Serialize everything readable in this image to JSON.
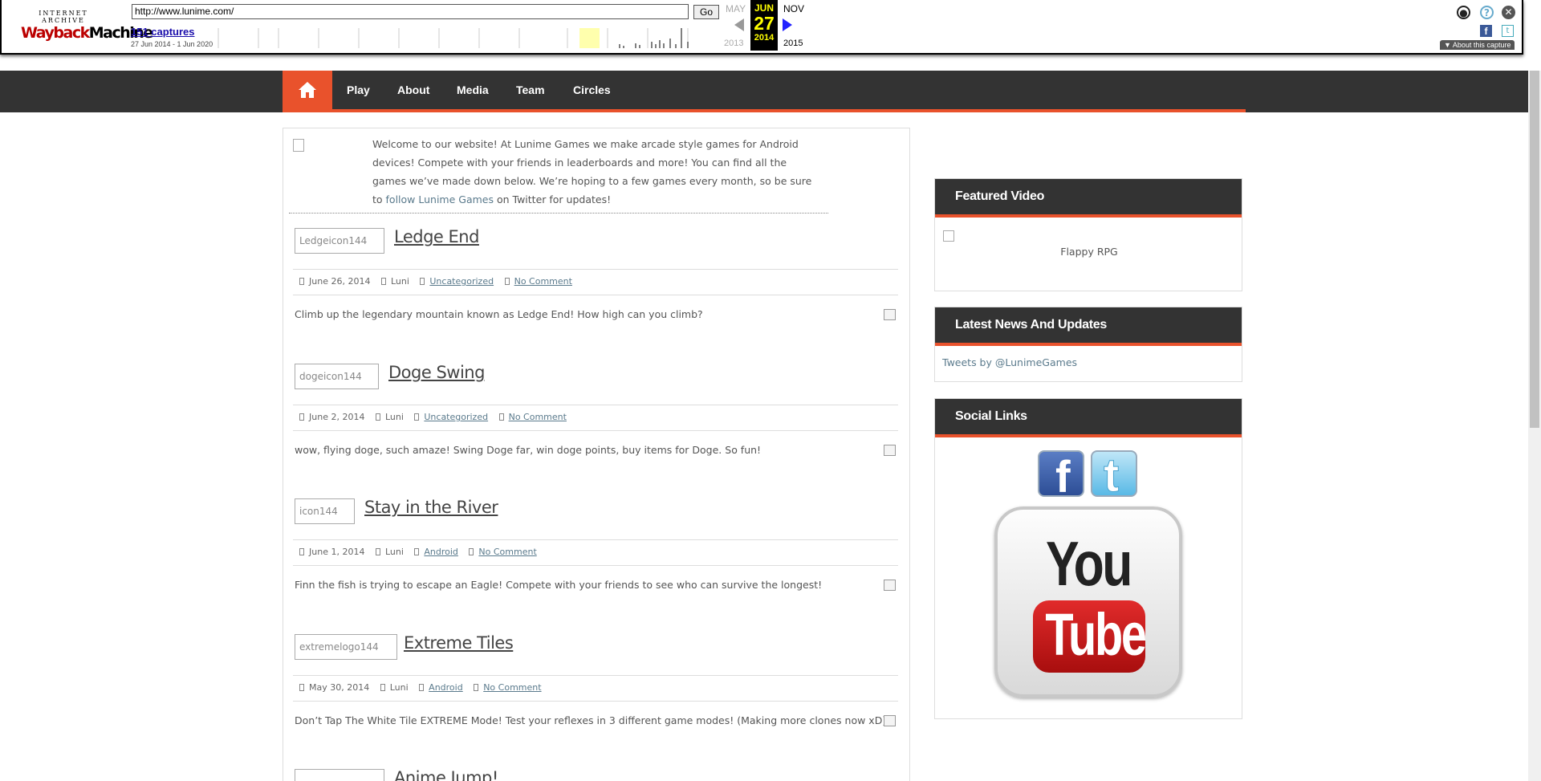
{
  "wayback": {
    "logo_top": "INTERNET ARCHIVE",
    "logo_main": "WaybackMachine",
    "url": "http://www.lunime.com/",
    "go_label": "Go",
    "captures_label": "151 captures",
    "range_label": "27 Jun 2014 - 1 Jun 2020",
    "prev_month": "MAY",
    "prev_year": "2013",
    "cur_month": "JUN",
    "cur_day": "27",
    "cur_year": "2014",
    "next_month": "NOV",
    "next_year": "2015",
    "about_label": "▼ About this capture",
    "icons": {
      "user": "user-icon",
      "help": "help-icon",
      "close": "close-icon",
      "facebook": "facebook-icon",
      "twitter": "twitter-icon"
    },
    "help_glyph": "?",
    "close_glyph": "✕",
    "fb_glyph": "f",
    "tw_glyph": "t"
  },
  "nav": {
    "home_icon": "home-icon",
    "items": [
      "Play",
      "About",
      "Media",
      "Team",
      "Circles"
    ]
  },
  "welcome": {
    "text": "Welcome to our website! At Lunime Games we make arcade style games for Android devices! Compete with your friends in leaderboards and more! You can find all the games we’ve made down below. We’re hoping to a few games every month, so be sure to ",
    "link": "follow Lunime Games",
    "tail": " on Twitter for updates!"
  },
  "posts": [
    {
      "thumb_alt": "Ledgeicon144",
      "title": "Ledge End",
      "date": "June 26, 2014",
      "author": "Luni",
      "category": "Uncategorized",
      "comments": "No Comment",
      "excerpt": "Climb up the legendary mountain known as Ledge End! How high can you climb?"
    },
    {
      "thumb_alt": "dogeicon144",
      "title": "Doge Swing",
      "date": "June 2, 2014",
      "author": "Luni",
      "category": "Uncategorized",
      "comments": "No Comment",
      "excerpt": "wow, flying doge, such amaze! Swing Doge far, win doge points, buy items for Doge. So fun!"
    },
    {
      "thumb_alt": "icon144",
      "title": "Stay in the River",
      "date": "June 1, 2014",
      "author": "Luni",
      "category": "Android",
      "comments": "No Comment",
      "excerpt": "Finn the fish is trying to escape an Eagle! Compete with your friends to see who can survive the longest!"
    },
    {
      "thumb_alt": "extremelogo144",
      "title": "Extreme Tiles",
      "date": "May 30, 2014",
      "author": "Luni",
      "category": "Android",
      "comments": "No Comment",
      "excerpt": "Don’t Tap The White Tile EXTREME Mode! Test your reflexes in 3 different game modes! (Making more clones now xD)"
    },
    {
      "thumb_alt": "",
      "title": "Anime Jump!",
      "date": "",
      "author": "",
      "category": "",
      "comments": "",
      "excerpt": ""
    }
  ],
  "sidebar": {
    "featured_title": "Featured Video",
    "featured_video": "Flappy RPG",
    "news_title": "Latest News And Updates",
    "tweets_link": "Tweets by @LunimeGames",
    "social_title": "Social Links",
    "youtube_you": "You",
    "youtube_tube": "Tube",
    "fb_glyph": "f",
    "tw_glyph": "t"
  },
  "colors": {
    "accent": "#e9522c",
    "nav_bg": "#333333",
    "link": "#5a7a8c"
  }
}
